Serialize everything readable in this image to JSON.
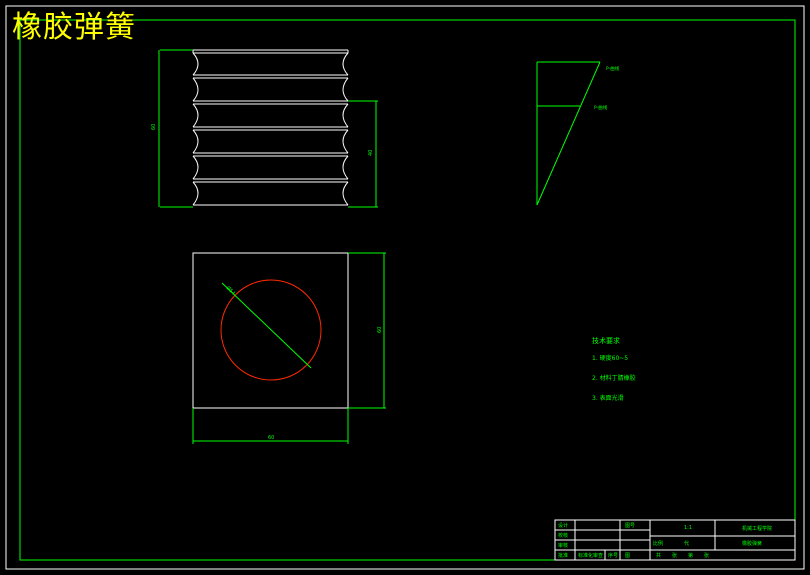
{
  "drawing": {
    "title": "橡胶弹簧",
    "background": "#000000",
    "colors": {
      "frame": "#ffffff",
      "dims": "#00ff00",
      "circle": "#ff2a00",
      "title": "#ffff00"
    }
  },
  "side_view": {
    "dim_height_label": "60",
    "dim_partial_label": "40"
  },
  "load_diagram": {
    "label_top": "P-曲线",
    "label_mid": "P-曲线"
  },
  "top_view": {
    "dim_diameter_label": "Ø54",
    "dim_side_label": "60",
    "dim_width_label": "60"
  },
  "technical_requirements": {
    "heading": "技术要求",
    "items": [
      "1. 硬度60~5",
      "2. 材料丁腈橡胶",
      "3. 表面光滑"
    ]
  },
  "title_block": {
    "designer": "设计",
    "checker": "校核",
    "reviewer": "审核",
    "approver": "批准",
    "part_name": "橡胶弹簧",
    "scale": "1:1",
    "institution": "机械工程学院",
    "standard_label": "标准化审查",
    "weight_label": "重量",
    "qty": "共",
    "sheet_label": "比例",
    "sheet_value": "第",
    "drawing_no": "图号",
    "seq": "序号",
    "code": "代",
    "seal": "图",
    "date_labels": [
      "共",
      "张",
      "第",
      "张"
    ]
  }
}
